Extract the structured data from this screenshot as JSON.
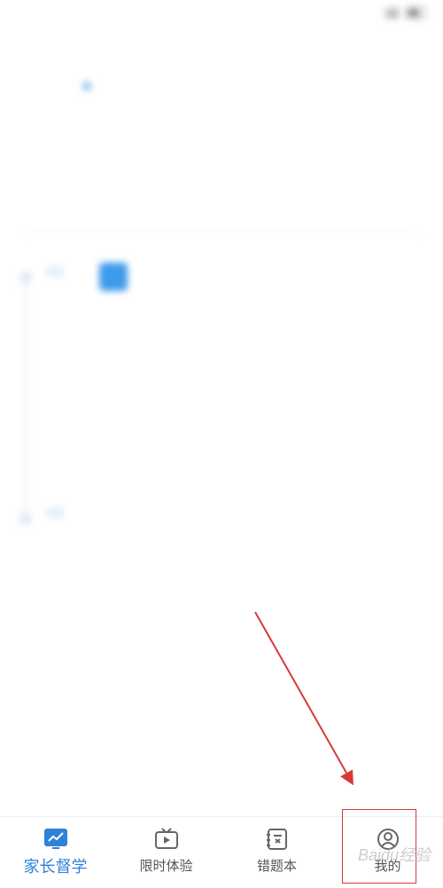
{
  "status_bar": {
    "left_text": "",
    "time": ""
  },
  "top_tabs": [
    {
      "label": "",
      "active": true
    },
    {
      "label": "",
      "active": false
    },
    {
      "label": "",
      "active": false
    },
    {
      "label": "",
      "active": false
    }
  ],
  "content": {
    "section_title": "",
    "summary_label": "",
    "summary_text": "",
    "divider_label": "",
    "subject_tag": "",
    "badge_text": "",
    "description": "",
    "question_1_title": "",
    "question_1_meta": "",
    "question_2_title": "",
    "question_2_meta": "",
    "status_tag": "",
    "no_more_text": ""
  },
  "bottom_nav": {
    "items": [
      {
        "label": "家长督学",
        "icon": "chart-trend-icon",
        "active": true
      },
      {
        "label": "限时体验",
        "icon": "tv-play-icon",
        "active": false
      },
      {
        "label": "错题本",
        "icon": "notebook-icon",
        "active": false
      },
      {
        "label": "我的",
        "icon": "user-profile-icon",
        "active": false
      }
    ]
  },
  "annotation": {
    "arrow_color": "#d63a3a",
    "box_color": "#d63a3a"
  },
  "watermark": "Baidu经验",
  "colors": {
    "accent": "#2e82d8",
    "tag_bg": "#e3eefb",
    "badge": "#3d9bea"
  }
}
